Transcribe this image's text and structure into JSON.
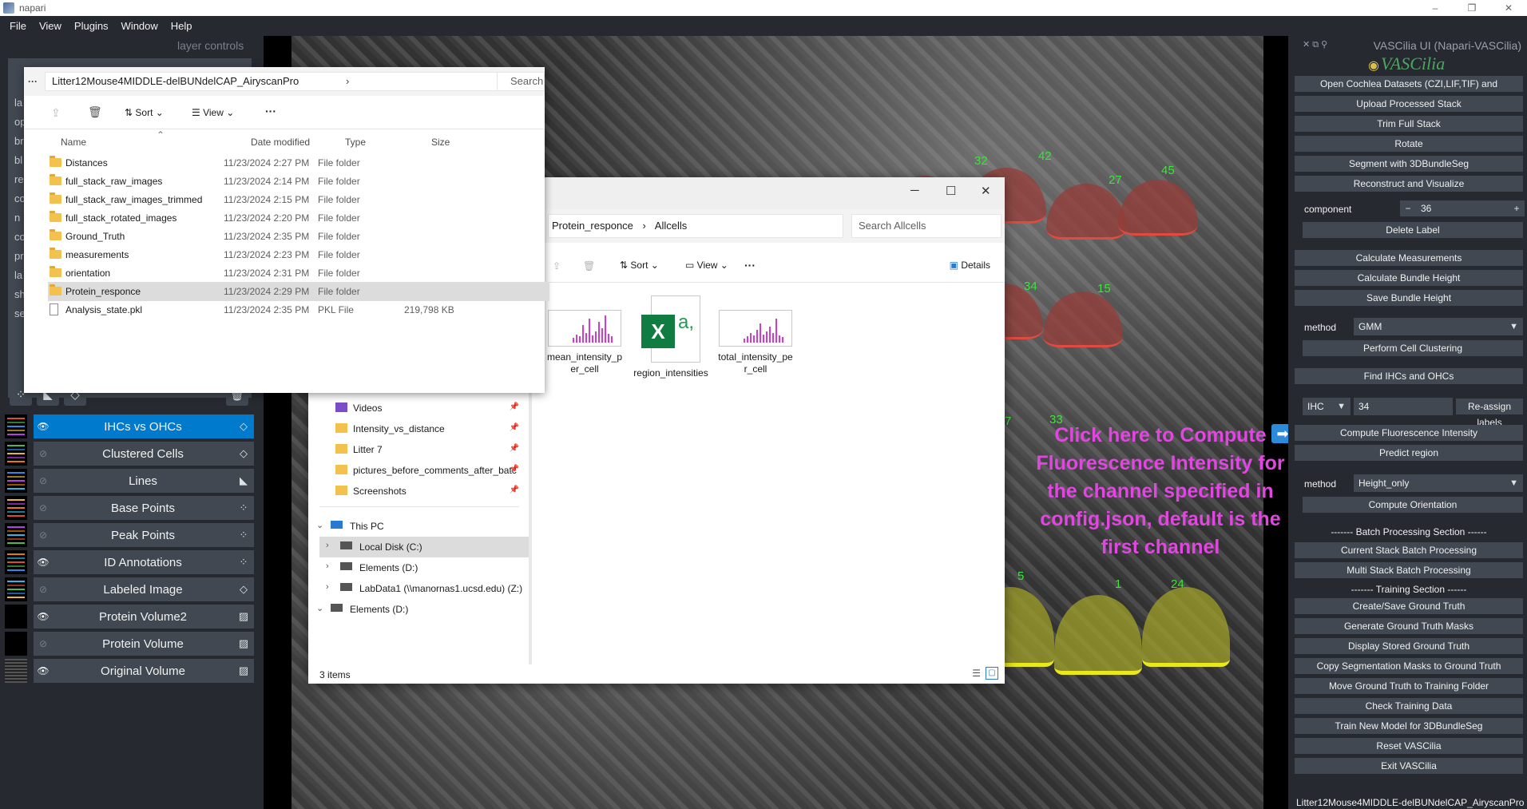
{
  "window": {
    "title": "napari",
    "controls": [
      "–",
      "❐",
      "✕"
    ]
  },
  "menu": [
    "File",
    "View",
    "Plugins",
    "Window",
    "Help"
  ],
  "layer_controls": {
    "title": "layer controls",
    "labels": [
      "la",
      "op",
      "br",
      "bl",
      "re",
      "co",
      "n",
      "co",
      "pr",
      "la",
      "sh",
      "se"
    ]
  },
  "layer_list": [
    {
      "name": "IHCs vs OHCs",
      "visible": true,
      "selected": true,
      "type": "labels-icon"
    },
    {
      "name": "Clustered Cells",
      "visible": false,
      "selected": false,
      "type": "labels-icon"
    },
    {
      "name": "Lines",
      "visible": false,
      "selected": false,
      "type": "shapes-icon"
    },
    {
      "name": "Base Points",
      "visible": false,
      "selected": false,
      "type": "points-icon"
    },
    {
      "name": "Peak Points",
      "visible": false,
      "selected": false,
      "type": "points-icon"
    },
    {
      "name": "ID Annotations",
      "visible": true,
      "selected": false,
      "type": "points-icon"
    },
    {
      "name": "Labeled Image",
      "visible": false,
      "selected": false,
      "type": "labels-icon"
    },
    {
      "name": "Protein Volume2",
      "visible": true,
      "selected": false,
      "type": "image-icon"
    },
    {
      "name": "Protein Volume",
      "visible": false,
      "selected": false,
      "type": "image-icon"
    },
    {
      "name": "Original Volume",
      "visible": true,
      "selected": false,
      "type": "image-icon"
    }
  ],
  "canvas": {
    "cell_numbers": [
      "32",
      "42",
      "27",
      "45",
      "34",
      "15",
      "33",
      "7",
      "5",
      "1",
      "24"
    ],
    "annotation": "Click here to Compute Fluorescence Intensity for the channel specified in config.json, default is the first channel",
    "annotation_color": "#e046e0"
  },
  "right_panel": {
    "title": "VASCilia UI (Napari-VASCilia)",
    "logo": "VASCilia",
    "buttons_top": [
      "Open Cochlea Datasets (CZI,LIF,TIF) and Preprocess",
      "Upload Processed Stack",
      "Trim Full Stack",
      "Rotate",
      "Segment with 3DBundleSeg",
      "Reconstruct and Visualize"
    ],
    "component_label": "component",
    "component_value": "36",
    "delete_label": "Delete Label",
    "buttons_measure": [
      "Calculate Measurements",
      "Calculate Bundle Height",
      "Save Bundle Height"
    ],
    "method_label": "method",
    "method_value": "GMM",
    "perform_clustering": "Perform Cell Clustering",
    "find_ihcs": "Find IHCs and OHCs",
    "cell_type": "IHC",
    "cell_id": "34",
    "reassign": "Re-assign labels",
    "compute_fluo": "Compute Fluorescence Intensity",
    "predict_region": "Predict region",
    "method2_label": "method",
    "method2_value": "Height_only",
    "compute_orientation": "Compute Orientation",
    "batch_section": "------- Batch Processing Section ------",
    "batch_buttons": [
      "Current Stack Batch Processing",
      "Multi Stack Batch Processing"
    ],
    "training_section": "------- Training Section ------",
    "training_buttons": [
      "Create/Save Ground Truth",
      "Generate Ground Truth Masks",
      "Display Stored Ground Truth",
      "Copy Segmentation Masks to Ground Truth",
      "Move Ground Truth to Training Folder",
      "Check Training Data",
      "Train New Model for 3DBundleSeg",
      "Reset VASCilia",
      "Exit VASCilia"
    ],
    "footer": "Litter12Mouse4MIDDLE-delBUNdelCAP_AiryscanPro"
  },
  "explorer_front": {
    "path": "Litter12Mouse4MIDDLE-delBUNdelCAP_AiryscanPro",
    "search": "Search Li",
    "cmd": {
      "sort": "Sort",
      "view": "View",
      "more": "···"
    },
    "columns": [
      "Name",
      "Date modified",
      "Type",
      "Size"
    ],
    "rows": [
      {
        "name": "Distances",
        "date": "11/23/2024 2:27 PM",
        "type": "File folder",
        "size": "",
        "kind": "folder",
        "selected": false
      },
      {
        "name": "full_stack_raw_images",
        "date": "11/23/2024 2:14 PM",
        "type": "File folder",
        "size": "",
        "kind": "folder",
        "selected": false
      },
      {
        "name": "full_stack_raw_images_trimmed",
        "date": "11/23/2024 2:15 PM",
        "type": "File folder",
        "size": "",
        "kind": "folder",
        "selected": false
      },
      {
        "name": "full_stack_rotated_images",
        "date": "11/23/2024 2:20 PM",
        "type": "File folder",
        "size": "",
        "kind": "folder",
        "selected": false
      },
      {
        "name": "Ground_Truth",
        "date": "11/23/2024 2:35 PM",
        "type": "File folder",
        "size": "",
        "kind": "folder",
        "selected": false
      },
      {
        "name": "measurements",
        "date": "11/23/2024 2:23 PM",
        "type": "File folder",
        "size": "",
        "kind": "folder",
        "selected": false
      },
      {
        "name": "orientation",
        "date": "11/23/2024 2:31 PM",
        "type": "File folder",
        "size": "",
        "kind": "folder",
        "selected": false
      },
      {
        "name": "Protein_responce",
        "date": "11/23/2024 2:29 PM",
        "type": "File folder",
        "size": "",
        "kind": "folder",
        "selected": true
      },
      {
        "name": "Analysis_state.pkl",
        "date": "11/23/2024 2:35 PM",
        "type": "PKL File",
        "size": "219,798 KB",
        "kind": "file",
        "selected": false
      }
    ]
  },
  "explorer_back": {
    "path": [
      "Protein_responce",
      "Allcells"
    ],
    "search": "Search Allcells",
    "cmd": {
      "sort": "Sort",
      "view": "View",
      "more": "···",
      "details": "Details"
    },
    "nav": [
      {
        "name": "Videos",
        "pinned": true
      },
      {
        "name": "Intensity_vs_distance",
        "pinned": true
      },
      {
        "name": "Litter 7",
        "pinned": true
      },
      {
        "name": "pictures_before_comments_after_batc",
        "pinned": true
      },
      {
        "name": "Screenshots",
        "pinned": true
      }
    ],
    "tree": [
      {
        "name": "This PC",
        "expanded": true,
        "level": 0
      },
      {
        "name": "Local Disk (C:)",
        "expanded": false,
        "level": 1,
        "selected": true
      },
      {
        "name": "Elements (D:)",
        "expanded": false,
        "level": 1
      },
      {
        "name": "LabData1 (\\\\manornas1.ucsd.edu) (Z:)",
        "expanded": false,
        "level": 1
      },
      {
        "name": "Elements (D:)",
        "expanded": true,
        "level": 0
      }
    ],
    "files": [
      {
        "name": "mean_intensity_per_cell",
        "lines": [
          "mean_intensity_p",
          "er_cell"
        ],
        "kind": "image"
      },
      {
        "name": "region_intensities",
        "lines": [
          "region_intensities"
        ],
        "kind": "excel"
      },
      {
        "name": "total_intensity_per_cell",
        "lines": [
          "total_intensity_pe",
          "r_cell"
        ],
        "kind": "image"
      }
    ],
    "status": "3 items"
  }
}
